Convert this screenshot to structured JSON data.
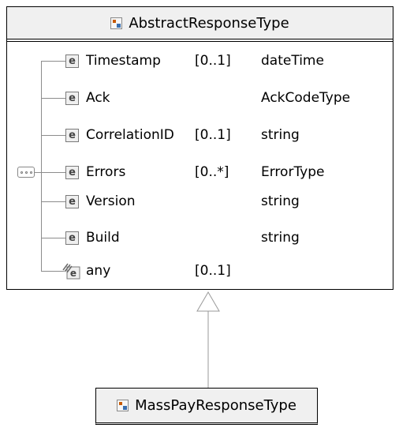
{
  "base_type": {
    "name": "AbstractResponseType",
    "icon": "complex-type-icon"
  },
  "elements": [
    {
      "name": "Timestamp",
      "cardinality": "[0..1]",
      "type": "dateTime",
      "badge": "e"
    },
    {
      "name": "Ack",
      "cardinality": "",
      "type": "AckCodeType",
      "badge": "e"
    },
    {
      "name": "CorrelationID",
      "cardinality": "[0..1]",
      "type": "string",
      "badge": "e"
    },
    {
      "name": "Errors",
      "cardinality": "[0..*]",
      "type": "ErrorType",
      "badge": "e"
    },
    {
      "name": "Version",
      "cardinality": "",
      "type": "string",
      "badge": "e"
    },
    {
      "name": "Build",
      "cardinality": "",
      "type": "string",
      "badge": "e"
    },
    {
      "name": "any",
      "cardinality": "[0..1]",
      "type": "",
      "badge": "any-wildcard-icon"
    }
  ],
  "derived_type": {
    "name": "MassPayResponseType",
    "icon": "complex-type-icon"
  },
  "relationship": "extension",
  "compositor": "sequence-icon"
}
